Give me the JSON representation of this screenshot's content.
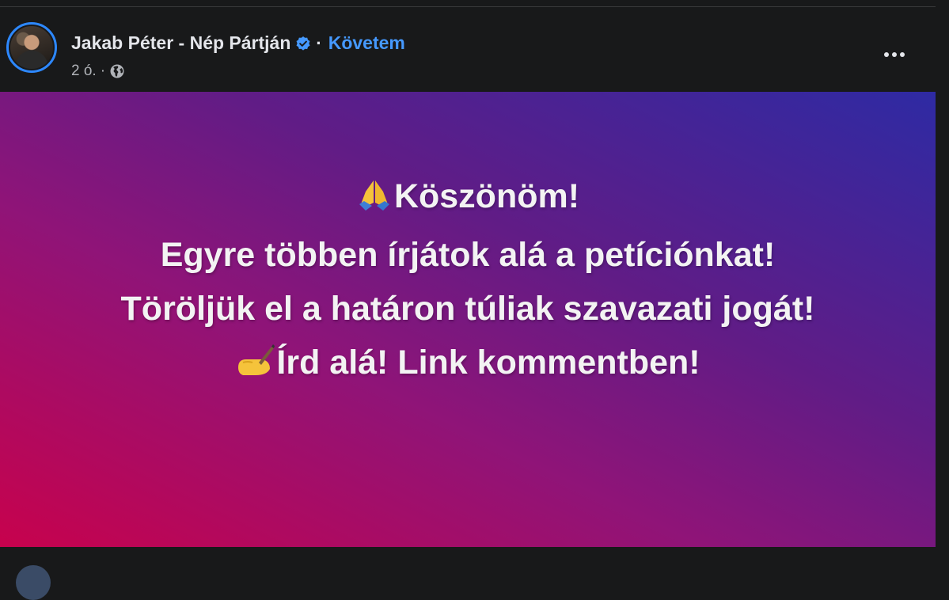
{
  "post": {
    "author": "Jakab Péter - Nép Pártján",
    "separator": "·",
    "follow_label": "Követem",
    "time": "2 ó.",
    "meta_separator": "·",
    "privacy_icon": "globe-icon",
    "verified_icon": "verified-badge-icon",
    "more_icon": "more-horizontal-icon"
  },
  "image": {
    "gradient_colors": [
      "#c7024d",
      "#8f1478",
      "#611c86",
      "#2e2aa3"
    ],
    "lines": [
      {
        "emoji": "🙏",
        "text": "Köszönöm!"
      },
      {
        "emoji": "",
        "text": "Egyre többen írjátok alá a petíciónkat!"
      },
      {
        "emoji": "",
        "text": "Töröljük el a határon túliak szavazati jogát!"
      },
      {
        "emoji": "✍️",
        "text": "Írd alá! Link kommentben!"
      }
    ]
  },
  "colors": {
    "background": "#18191a",
    "text_primary": "#e4e6eb",
    "text_secondary": "#b0b3b8",
    "accent": "#4599ff"
  }
}
